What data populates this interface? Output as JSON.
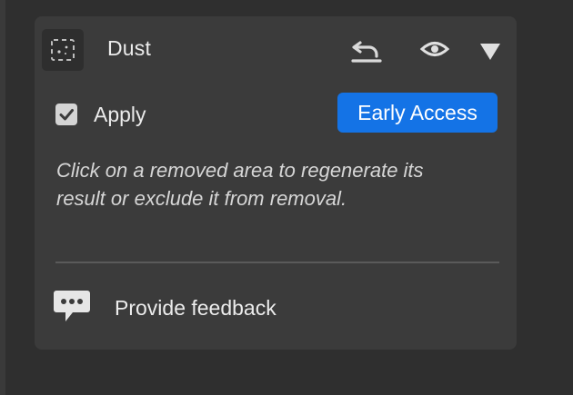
{
  "panel": {
    "title": "Dust",
    "tool_icon": "dust-removal-icon",
    "header_actions": [
      {
        "name": "reset",
        "icon": "undo-icon"
      },
      {
        "name": "visibility",
        "icon": "eye-icon"
      },
      {
        "name": "collapse",
        "icon": "triangle-down-icon"
      }
    ],
    "apply": {
      "label": "Apply",
      "checked": true
    },
    "badge": {
      "label": "Early Access",
      "color": "#1473e6"
    },
    "hint": "Click on a removed area to regenerate its result or exclude it from removal.",
    "feedback": {
      "label": "Provide feedback",
      "icon": "speech-bubble-icon"
    }
  },
  "colors": {
    "background": "#2f2f2f",
    "panel": "#3b3b3b",
    "text": "#ececec",
    "accent": "#1473e6"
  }
}
